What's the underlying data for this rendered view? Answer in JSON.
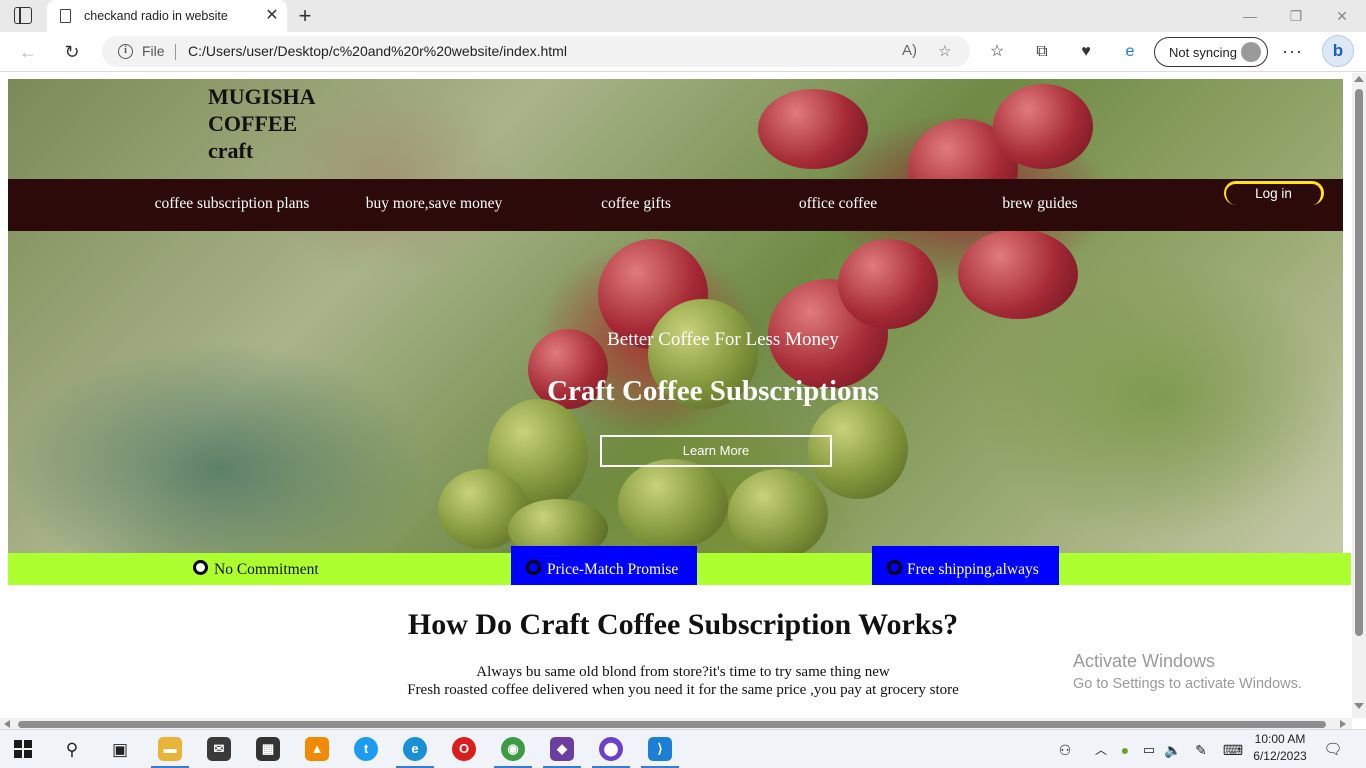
{
  "browser": {
    "tab_title": "checkand radio in website",
    "address_prefix": "File",
    "url": "C:/Users/user/Desktop/c%20and%20r%20website/index.html",
    "profile_label": "Not syncing",
    "bing_label": "b"
  },
  "site": {
    "brand_lines": [
      "MUGISHA",
      "COFFEE",
      "craft"
    ],
    "nav": [
      "coffee subscription plans",
      "buy more,save money",
      "coffee gifts",
      "office coffee",
      "brew guides"
    ],
    "login_label": "Log in",
    "hero_subtitle": "Better Coffee For Less Money",
    "hero_title": "Craft Coffee Subscriptions",
    "cta_label": "Learn More",
    "features": [
      {
        "label": "No Commitment",
        "highlighted": false
      },
      {
        "label": "Price-Match Promise",
        "highlighted": true
      },
      {
        "label": "Free shipping,always",
        "highlighted": true
      }
    ],
    "section_title": "How Do Craft Coffee Subscription Works?",
    "section_lines": [
      "Always bu same old blond from store?it's time to try same thing new",
      "Fresh roasted coffee delivered when you need it for the same price ,you pay at grocery store"
    ],
    "colors": {
      "navbar": "#2c0a0a",
      "feature_bar": "#adff2f",
      "feature_highlight": "#0000ff",
      "login_border": "#ffe21a"
    }
  },
  "watermark": {
    "title": "Activate Windows",
    "subtitle": "Go to Settings to activate Windows."
  },
  "taskbar": {
    "apps": [
      "start-icon",
      "search-icon",
      "task-view-icon",
      "file-explorer-icon",
      "mail-icon",
      "store-icon",
      "vlc-icon",
      "twitter-icon",
      "edge-icon",
      "opera-icon",
      "chrome-icon",
      "app-icon",
      "github-icon",
      "vscode-icon"
    ],
    "time": "10:00 AM",
    "date": "6/12/2023"
  }
}
